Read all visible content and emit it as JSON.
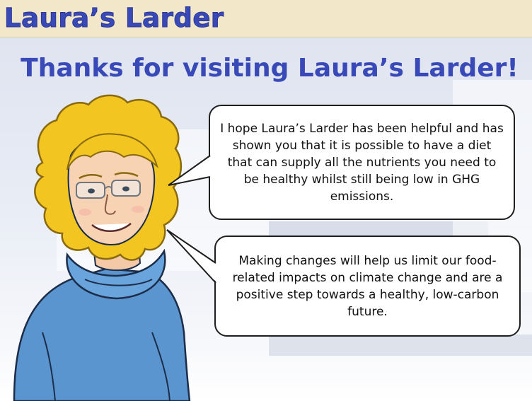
{
  "header": {
    "brand": "Laura’s Larder"
  },
  "main": {
    "title": "Thanks for visiting Laura’s Larder!",
    "bubble1": "I hope Laura’s Larder has been helpful and has shown you that it is possible to have a diet that can supply all the nutrients you need to be healthy whilst still being low in GHG emissions.",
    "bubble2": "Making changes will help us limit our food-related impacts on climate change and are a positive step towards a healthy, low-carbon future."
  },
  "colors": {
    "brand": "#3a49b8",
    "header_bg": "#f2e7c9",
    "sweater": "#5b95cf",
    "hair": "#f3c521"
  },
  "icons": {
    "character": "laura-character-illustration"
  }
}
